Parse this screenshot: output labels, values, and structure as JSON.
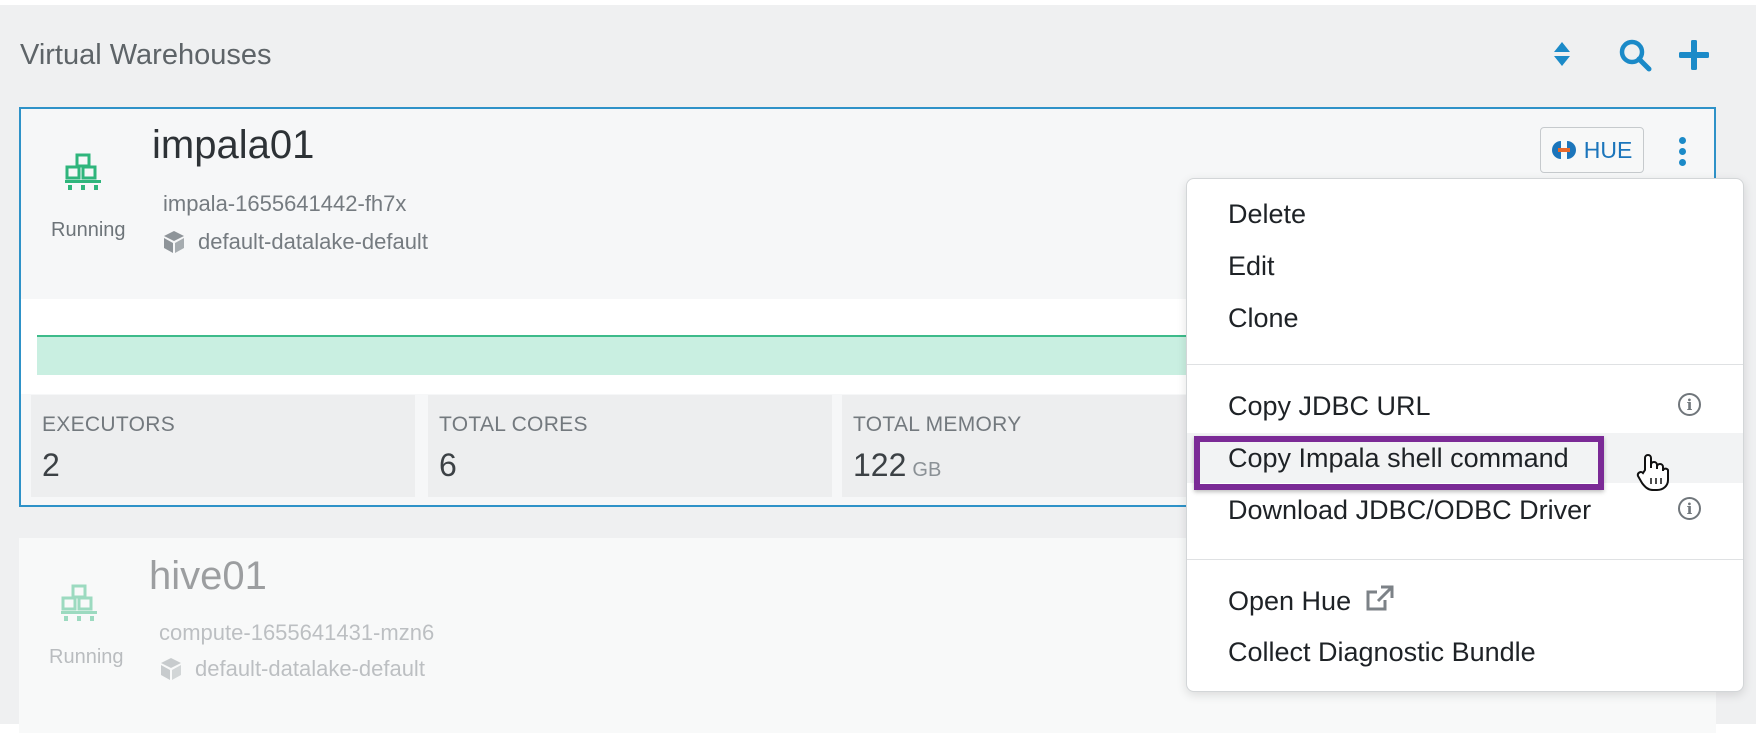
{
  "header": {
    "title": "Virtual Warehouses",
    "icons": [
      "sort-icon",
      "search-icon",
      "add-icon"
    ]
  },
  "warehouses": [
    {
      "name": "impala01",
      "status": "Running",
      "id": "impala-1655641442-fh7x",
      "environment": "default-datalake-default",
      "hue_label": "HUE",
      "stats": [
        {
          "label": "EXECUTORS",
          "value": "2",
          "unit": ""
        },
        {
          "label": "TOTAL CORES",
          "value": "6",
          "unit": ""
        },
        {
          "label": "TOTAL MEMORY",
          "value": "122",
          "unit": "GB"
        }
      ]
    },
    {
      "name": "hive01",
      "status": "Running",
      "id": "compute-1655641431-mzn6",
      "environment": "default-datalake-default"
    }
  ],
  "menu": {
    "items": [
      {
        "label": "Delete"
      },
      {
        "label": "Edit"
      },
      {
        "label": "Clone"
      },
      {
        "label": "Copy JDBC URL",
        "info": "i"
      },
      {
        "label": "Copy Impala shell command"
      },
      {
        "label": "Download JDBC/ODBC Driver",
        "info": "i"
      },
      {
        "label": "Open Hue"
      },
      {
        "label": "Collect Diagnostic Bundle"
      }
    ]
  },
  "colors": {
    "accent": "#1b8ac8",
    "running_green": "#3dbb8a",
    "highlight": "#7b2a96",
    "selected_border": "#2e92c8"
  }
}
